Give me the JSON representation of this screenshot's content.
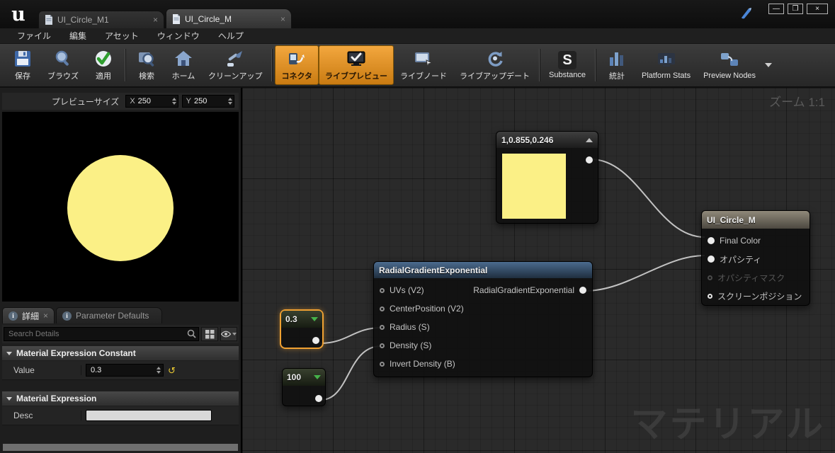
{
  "icons": {
    "minimize": "—",
    "maximize": "❒",
    "window_close": "×",
    "tab_close": "×",
    "info": "i",
    "substance": "S",
    "reset": "↺",
    "logo": "u"
  },
  "window": {
    "tabs": [
      {
        "label": "UI_Circle_M1",
        "active": false
      },
      {
        "label": "UI_Circle_M",
        "active": true
      }
    ]
  },
  "menu": {
    "items": [
      "ファイル",
      "編集",
      "アセット",
      "ウィンドウ",
      "ヘルプ"
    ]
  },
  "toolbar": {
    "items": [
      {
        "label": "保存",
        "active": false
      },
      {
        "label": "ブラウズ",
        "active": false
      },
      {
        "label": "適用",
        "active": false
      },
      {
        "label": "検索",
        "active": false
      },
      {
        "label": "ホーム",
        "active": false
      },
      {
        "label": "クリーンアップ",
        "active": false
      },
      {
        "label": "コネクタ",
        "active": true
      },
      {
        "label": "ライブプレビュー",
        "active": true
      },
      {
        "label": "ライブノード",
        "active": false
      },
      {
        "label": "ライブアップデート",
        "active": false
      },
      {
        "label": "Substance",
        "active": false
      },
      {
        "label": "統計",
        "active": false
      },
      {
        "label": "Platform Stats",
        "active": false
      },
      {
        "label": "Preview Nodes",
        "active": false
      }
    ]
  },
  "preview": {
    "size_label": "プレビューサイズ",
    "x_label": "X",
    "x_value": "250",
    "y_label": "Y",
    "y_value": "250",
    "circle_color": "#FBF086"
  },
  "details": {
    "tab_details": "詳細",
    "tab_parameters": "Parameter Defaults",
    "search_placeholder": "Search Details",
    "section_constant": {
      "title": "Material Expression Constant",
      "rows": [
        {
          "label": "Value",
          "value": "0.3"
        }
      ]
    },
    "section_expression": {
      "title": "Material Expression",
      "rows": [
        {
          "label": "Desc",
          "value": ""
        }
      ]
    }
  },
  "graph": {
    "zoom_label": "ズーム 1:1",
    "watermark": "マテリアル",
    "nodes": {
      "color_constant": {
        "title": "1,0.855,0.246",
        "swatch_color": "#FBF086"
      },
      "radial": {
        "title": "RadialGradientExponential",
        "inputs": [
          "UVs (V2)",
          "CenterPosition (V2)",
          "Radius (S)",
          "Density (S)",
          "Invert Density (B)"
        ],
        "output": "RadialGradientExponential"
      },
      "result": {
        "title": "UI_Circle_M",
        "pins": [
          {
            "label": "Final Color",
            "connected": true,
            "disabled": false
          },
          {
            "label": "オパシティ",
            "connected": true,
            "disabled": false
          },
          {
            "label": "オパシティマスク",
            "connected": false,
            "disabled": true
          },
          {
            "label": "スクリーンポジション",
            "connected": false,
            "disabled": false
          }
        ]
      },
      "const_radius": {
        "title": "0.3",
        "selected": true
      },
      "const_density": {
        "title": "100",
        "selected": false
      }
    }
  }
}
